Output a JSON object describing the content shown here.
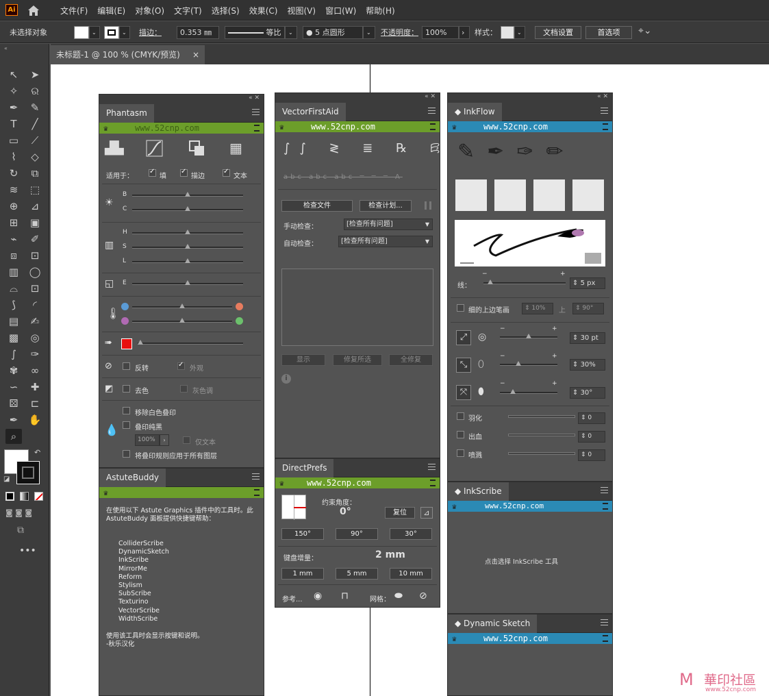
{
  "app": {
    "logo": "Ai",
    "menus": [
      "文件(F)",
      "编辑(E)",
      "对象(O)",
      "文字(T)",
      "选择(S)",
      "效果(C)",
      "视图(V)",
      "窗口(W)",
      "帮助(H)"
    ]
  },
  "control": {
    "no_selection": "未选择对象",
    "stroke_label": "描边：",
    "stroke_value": "0.353 ㎜",
    "profile": "等比",
    "brush": "5 点圆形",
    "opacity_label": "不透明度：",
    "opacity_value": "100%",
    "style_label": "样式：",
    "doc_setup": "文档设置",
    "prefs": "首选项"
  },
  "document": {
    "tab_title": "未标题-1 @ 100 % (CMYK/预览)",
    "close": "×"
  },
  "phantasm": {
    "tab": "Phantasm",
    "url": "www.52cnp.com",
    "apply_to": "适用于：",
    "fill": "填",
    "stroke": "描边",
    "text": "文本",
    "b": "B",
    "c": "C",
    "h": "H",
    "s": "S",
    "l": "L",
    "e": "E",
    "invert": "反转",
    "appearance": "外观",
    "desaturate": "去色",
    "grayscale": "灰色调",
    "remove_white": "移除白色叠印",
    "overprint_black": "叠印纯黑",
    "percent": "100%",
    "text_only": "仅文本",
    "apply_all": "将叠印规则应用于所有图层",
    "sliders": {
      "B": 0.5,
      "C": 0.5,
      "H": 0.5,
      "S": 0.5,
      "L": 0.5,
      "E": 0.5,
      "temp1": 0.5,
      "temp2": 0.5,
      "fill": 0.0
    }
  },
  "astutebuddy": {
    "tab": "AstuteBuddy",
    "intro": "在使用以下 Astute Graphics 插件中的工具时。此 AstuteBuddy 面板提供快捷键帮助：",
    "plugins": [
      "ColliderScribe",
      "DynamicSketch",
      "InkScribe",
      "MirrorMe",
      "Reform",
      "Stylism",
      "SubScribe",
      "Texturino",
      "VectorScribe",
      "WidthScribe"
    ],
    "footer": "使用该工具时会显示按键和说明。",
    "credit": "-秋乐汉化"
  },
  "vfa": {
    "tab": "VectorFirstAid",
    "url": "www.52cnp.com",
    "check_file": "检查文件",
    "check_plan": "检查计划...",
    "manual": "手动检查：",
    "manual_value": "[检查所有问题]",
    "auto": "自动检查：",
    "auto_value": "[检查所有问题]",
    "show": "显示",
    "fix_selected": "修复所选",
    "fix_all": "全修复"
  },
  "directprefs": {
    "tab": "DirectPrefs",
    "url": "www.52cnp.com",
    "angle_label": "约束角度：",
    "angle_value": "0°",
    "reset": "复位",
    "angles": [
      "150°",
      "90°",
      "30°"
    ],
    "kb_label": "键盘增量：",
    "kb_value": "2 mm",
    "increments": [
      "1 mm",
      "5 mm",
      "10 mm"
    ],
    "ref": "参考...",
    "grid": "网格："
  },
  "inkflow": {
    "tab": "InkFlow",
    "url": "www.52cnp.com",
    "line_label": "线：",
    "line_value": "5 px",
    "taper": "细的上边笔画",
    "taper_pct": "10%",
    "up": "上",
    "up_deg": "90°",
    "size_value": "30 pt",
    "pct_value": "30%",
    "angle_value": "30°",
    "feather": "羽化",
    "bleed": "出血",
    "spray": "喷溅",
    "zero": "0",
    "line_slider": 0.05,
    "size_slider": 0.5,
    "pct_slider": 0.3,
    "ang_slider": 0.2
  },
  "inkscribe": {
    "tab": "InkScribe",
    "url": "www.52cnp.com",
    "hint": "点击选择 InkScribe 工具"
  },
  "dynsketch": {
    "tab": "Dynamic Sketch",
    "url": "www.52cnp.com"
  },
  "watermark": {
    "text": "華印社區",
    "sub": "www.52cnp.com"
  }
}
